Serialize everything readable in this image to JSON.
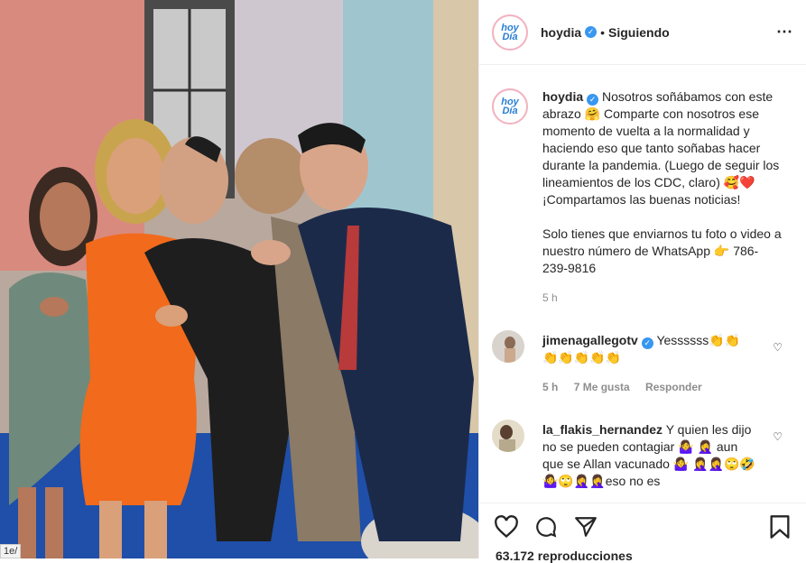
{
  "post": {
    "username": "hoydia",
    "avatar_text": "hoy Día",
    "follow_status": "Siguiendo",
    "caption_text": "Nosotros soñábamos con este abrazo 🤗 Comparte con nosotros ese momento de vuelta a la normalidad y haciendo eso que tanto soñabas hacer durante la pandemia. (Luego de seguir los lineamientos de los CDC, claro) 🥰❤️ ¡Compartamos las buenas noticias!\n\nSolo tienes que enviarnos tu foto o video a nuestro número de WhatsApp 👉 786-239-9816",
    "time_ago": "5 h",
    "views": "63.172 reproducciones"
  },
  "comments": [
    {
      "username": "jimenagallegotv",
      "verified": true,
      "text": "Yessssss👏👏 👏👏👏👏👏",
      "time": "5 h",
      "likes": "7 Me gusta",
      "reply": "Responder"
    },
    {
      "username": "la_flakis_hernandez",
      "verified": false,
      "text": "Y quien les dijo no se pueden contagiar 🤷‍♀️ 🤦‍♀️ aun que se Allan vacunado 🤷‍♀️ 🤦‍♀️🤦‍♀️🙄🤣🤷‍♀️🙄🤦‍♀️🤦‍♀️eso no es"
    }
  ],
  "ui": {
    "url_hint": "1e/",
    "more_icon": "⋯"
  },
  "colors": {
    "verified": "#3897f0",
    "dress": "#f26a1b",
    "floor": "#1f4fa8",
    "suit": "#1c2a4a"
  }
}
